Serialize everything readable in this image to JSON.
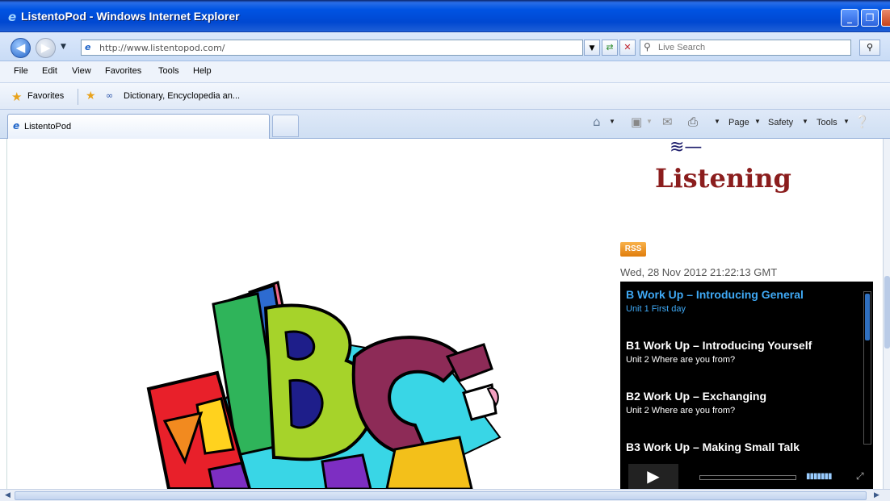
{
  "window": {
    "title": "ListentoPod - Windows Internet Explorer",
    "controls": [
      "_",
      "❐",
      "X"
    ]
  },
  "address": {
    "url": "http://www.listentopod.com/",
    "search_placeholder": "Live Search"
  },
  "menu": [
    "File",
    "Edit",
    "View",
    "Favorites",
    "Tools",
    "Help"
  ],
  "favorites": {
    "label": "Favorites",
    "link": "Dictionary, Encyclopedia an..."
  },
  "tabs": {
    "active": "ListentoPod"
  },
  "commandbar": {
    "page": "Page",
    "safety": "Safety",
    "tools": "Tools"
  },
  "page": {
    "logo_text": "Listening",
    "rss_label": "RSS",
    "feed_date": "Wed, 28 Nov 2012 21:22:13 GMT",
    "feed_items": [
      {
        "title": "B Work Up – Introducing General",
        "sub": "Unit 1  First day"
      },
      {
        "title": "B1 Work Up – Introducing Yourself",
        "sub": "Unit 2  Where are you from?"
      },
      {
        "title": "B2 Work Up – Exchanging",
        "sub": "Unit 2  Where are you from?"
      },
      {
        "title": "B3 Work Up – Making Small Talk",
        "sub": ""
      }
    ]
  },
  "colors": {
    "titlebar": "#0054e3",
    "logo": "#8b1d1d",
    "feed_bg": "#000000",
    "feed_highlight": "#3fa9f5",
    "rss": "#e07d0c"
  },
  "icons": [
    "ie-icon",
    "back-icon",
    "forward-icon",
    "refresh-icon",
    "stop-icon",
    "search-icon",
    "star-icon",
    "home-icon",
    "feeds-icon",
    "mail-icon",
    "print-icon",
    "help-icon",
    "play-icon"
  ]
}
